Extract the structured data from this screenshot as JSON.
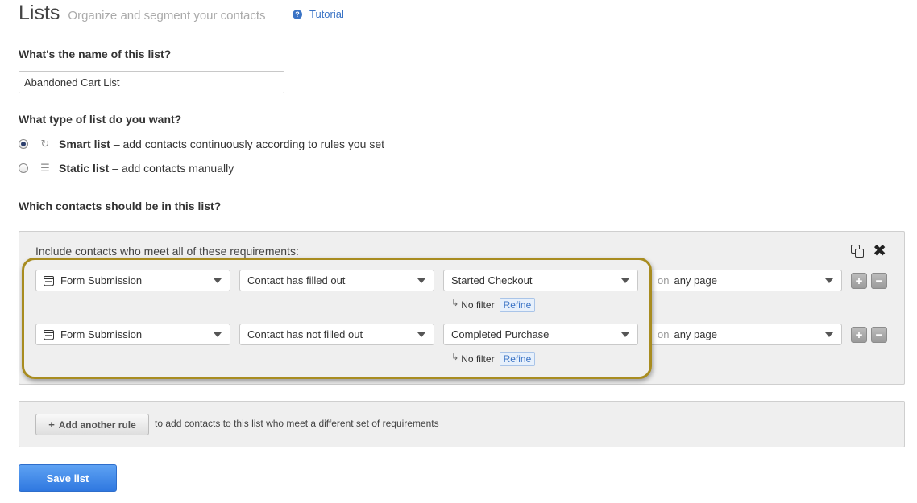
{
  "header": {
    "title": "Lists",
    "subtitle": "Organize and segment your contacts",
    "tutorial_label": "Tutorial"
  },
  "name_section": {
    "question": "What's the name of this list?",
    "value": "Abandoned Cart List"
  },
  "type_section": {
    "question": "What type of list do you want?",
    "options": [
      {
        "label": "Smart list",
        "description": "– add contacts continuously according to rules you set",
        "selected": true,
        "icon": "refresh-icon"
      },
      {
        "label": "Static list",
        "description": "– add contacts manually",
        "selected": false,
        "icon": "document-icon"
      }
    ]
  },
  "contacts_section": {
    "question": "Which contacts should be in this list?",
    "requirements_heading": "Include contacts who meet all of these requirements:",
    "rules": [
      {
        "source": "Form Submission",
        "condition": "Contact has filled out",
        "form": "Started Checkout",
        "on_label": "on",
        "page": "any page",
        "filter_label": "No filter",
        "refine_label": "Refine"
      },
      {
        "source": "Form Submission",
        "condition": "Contact has not filled out",
        "form": "Completed Purchase",
        "on_label": "on",
        "page": "any page",
        "filter_label": "No filter",
        "refine_label": "Refine"
      }
    ],
    "highlight_color": "#a88c20"
  },
  "add_rule": {
    "button_label": "Add another rule",
    "description": "to add contacts to this list who meet a different set of requirements"
  },
  "save_label": "Save list",
  "colors": {
    "accent": "#3a73c5",
    "save_button": "#2f78e0"
  }
}
